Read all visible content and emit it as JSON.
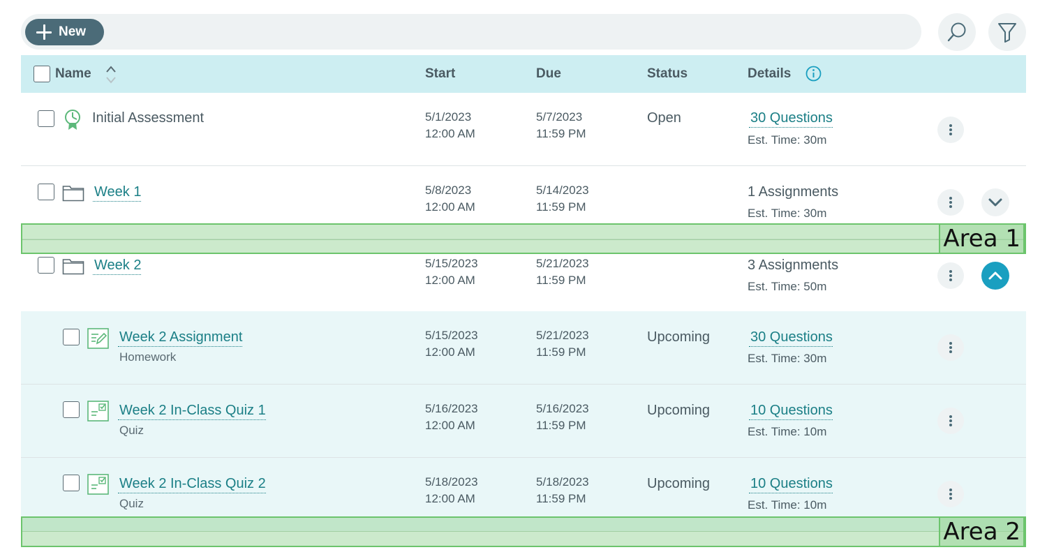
{
  "toolbar": {
    "new_label": "New",
    "search_icon": "search-icon",
    "filter_icon": "filter-icon"
  },
  "header": {
    "name": "Name",
    "start": "Start",
    "due": "Due",
    "status": "Status",
    "details": "Details"
  },
  "rows": [
    {
      "name": "Initial Assessment",
      "icon": "assessment-badge-icon",
      "start_date": "5/1/2023",
      "start_time": "12:00 AM",
      "due_date": "5/7/2023",
      "due_time": "11:59 PM",
      "status": "Open",
      "details": "30 Questions",
      "est": "Est. Time: 30m"
    },
    {
      "name": "Week 1",
      "icon": "folder-icon",
      "start_date": "5/8/2023",
      "start_time": "12:00 AM",
      "due_date": "5/14/2023",
      "due_time": "11:59 PM",
      "status": "",
      "details": "1 Assignments",
      "est": "Est. Time: 30m"
    },
    {
      "name": "Week 2",
      "icon": "folder-icon",
      "start_date": "5/15/2023",
      "start_time": "12:00 AM",
      "due_date": "5/21/2023",
      "due_time": "11:59 PM",
      "status": "",
      "details": "3 Assignments",
      "est": "Est. Time: 50m"
    },
    {
      "name": "Week 2 Assignment",
      "type": "Homework",
      "icon": "homework-icon",
      "start_date": "5/15/2023",
      "start_time": "12:00 AM",
      "due_date": "5/21/2023",
      "due_time": "11:59 PM",
      "status": "Upcoming",
      "details": "30 Questions",
      "est": "Est. Time: 30m"
    },
    {
      "name": "Week 2 In-Class Quiz 1",
      "type": "Quiz",
      "icon": "quiz-icon",
      "start_date": "5/16/2023",
      "start_time": "12:00 AM",
      "due_date": "5/16/2023",
      "due_time": "11:59 PM",
      "status": "Upcoming",
      "details": "10 Questions",
      "est": "Est. Time: 10m"
    },
    {
      "name": "Week 2 In-Class Quiz 2",
      "type": "Quiz",
      "icon": "quiz-icon",
      "start_date": "5/18/2023",
      "start_time": "12:00 AM",
      "due_date": "5/18/2023",
      "due_time": "11:59 PM",
      "status": "Upcoming",
      "details": "10 Questions",
      "est": "Est. Time: 10m"
    }
  ],
  "areas": {
    "area1": "Area 1",
    "area2": "Area 2"
  },
  "colors": {
    "header_bg": "#cdeef2",
    "link": "#1b7f86",
    "new_button": "#4b6b78",
    "expanded_toggle": "#1a9fc0",
    "subrow_bg": "#e9f7f8",
    "area_highlight": "#99d699"
  }
}
